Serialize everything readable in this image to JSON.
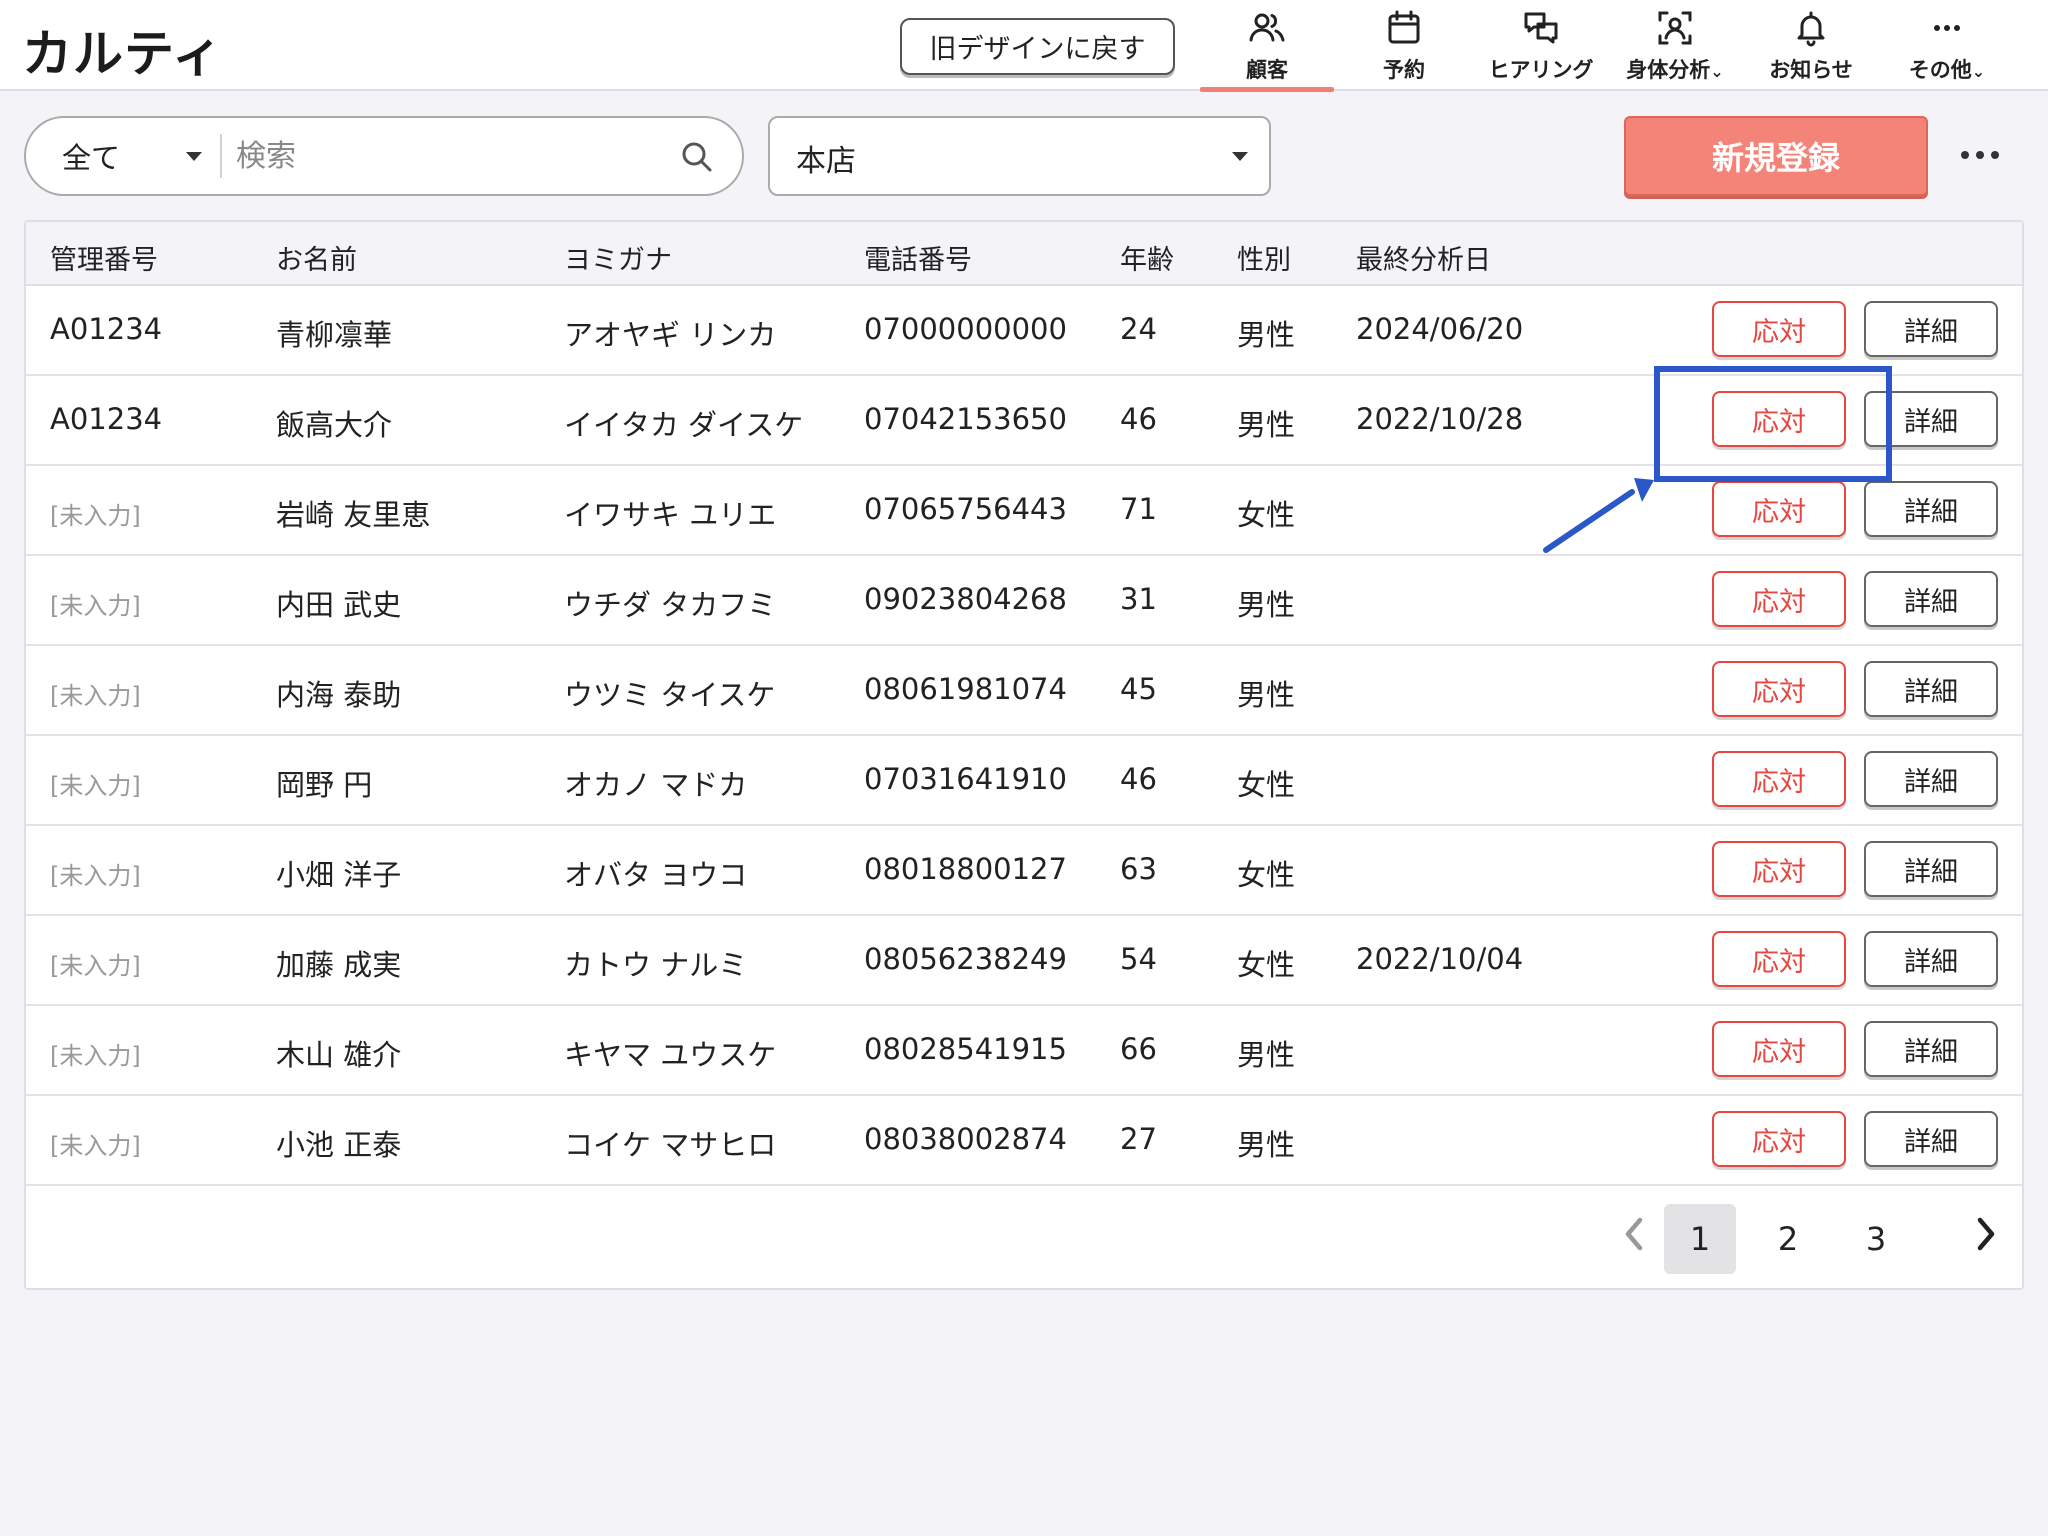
{
  "app": {
    "logo": "カルティ"
  },
  "header": {
    "old_design_button": "旧デザインに戻す",
    "nav": [
      {
        "label": "顧客",
        "icon": "users-icon",
        "active": true
      },
      {
        "label": "予約",
        "icon": "calendar-icon"
      },
      {
        "label": "ヒアリング",
        "icon": "chat-bubbles-icon"
      },
      {
        "label": "身体分析",
        "icon": "body-scan-icon"
      },
      {
        "label": "お知らせ",
        "icon": "bell-icon"
      },
      {
        "label": "その他",
        "icon": "more-dots-icon"
      }
    ],
    "nav_dropdown_marker": "⌄",
    "accent_color": "#f07f78"
  },
  "toolbar": {
    "filter_value": "全て",
    "search_placeholder": "検索",
    "store_value": "本店",
    "new_button": "新規登録"
  },
  "table": {
    "columns": [
      "管理番号",
      "お名前",
      "ヨミガナ",
      "電話番号",
      "年齢",
      "性別",
      "最終分析日"
    ],
    "respond_label": "応対",
    "detail_label": "詳細",
    "rows": [
      {
        "id": "A01234",
        "name": "青柳凛華",
        "kana": "アオヤギ リンカ",
        "phone": "07000000000",
        "age": "24",
        "gender": "男性",
        "last": "2024/06/20"
      },
      {
        "id": "A01234",
        "name": "飯高大介",
        "kana": "イイタカ ダイスケ",
        "phone": "07042153650",
        "age": "46",
        "gender": "男性",
        "last": "2022/10/28"
      },
      {
        "id": "[未入力]",
        "name": "岩崎 友里恵",
        "kana": "イワサキ ユリエ",
        "phone": "07065756443",
        "age": "71",
        "gender": "女性",
        "last": ""
      },
      {
        "id": "[未入力]",
        "name": "内田 武史",
        "kana": "ウチダ タカフミ",
        "phone": "09023804268",
        "age": "31",
        "gender": "男性",
        "last": ""
      },
      {
        "id": "[未入力]",
        "name": "内海 泰助",
        "kana": "ウツミ タイスケ",
        "phone": "08061981074",
        "age": "45",
        "gender": "男性",
        "last": ""
      },
      {
        "id": "[未入力]",
        "name": "岡野 円",
        "kana": "オカノ マドカ",
        "phone": "07031641910",
        "age": "46",
        "gender": "女性",
        "last": ""
      },
      {
        "id": "[未入力]",
        "name": "小畑 洋子",
        "kana": "オバタ ヨウコ",
        "phone": "08018800127",
        "age": "63",
        "gender": "女性",
        "last": ""
      },
      {
        "id": "[未入力]",
        "name": "加藤 成実",
        "kana": "カトウ ナルミ",
        "phone": "08056238249",
        "age": "54",
        "gender": "女性",
        "last": "2022/10/04"
      },
      {
        "id": "[未入力]",
        "name": "木山 雄介",
        "kana": "キヤマ ユウスケ",
        "phone": "08028541915",
        "age": "66",
        "gender": "男性",
        "last": ""
      },
      {
        "id": "[未入力]",
        "name": "小池 正泰",
        "kana": "コイケ マサヒロ",
        "phone": "08038002874",
        "age": "27",
        "gender": "男性",
        "last": ""
      }
    ]
  },
  "pagination": {
    "pages": [
      "1",
      "2",
      "3"
    ],
    "current": "1"
  },
  "annotation": {
    "color": "#2a58c8",
    "highlight_row": 2
  }
}
